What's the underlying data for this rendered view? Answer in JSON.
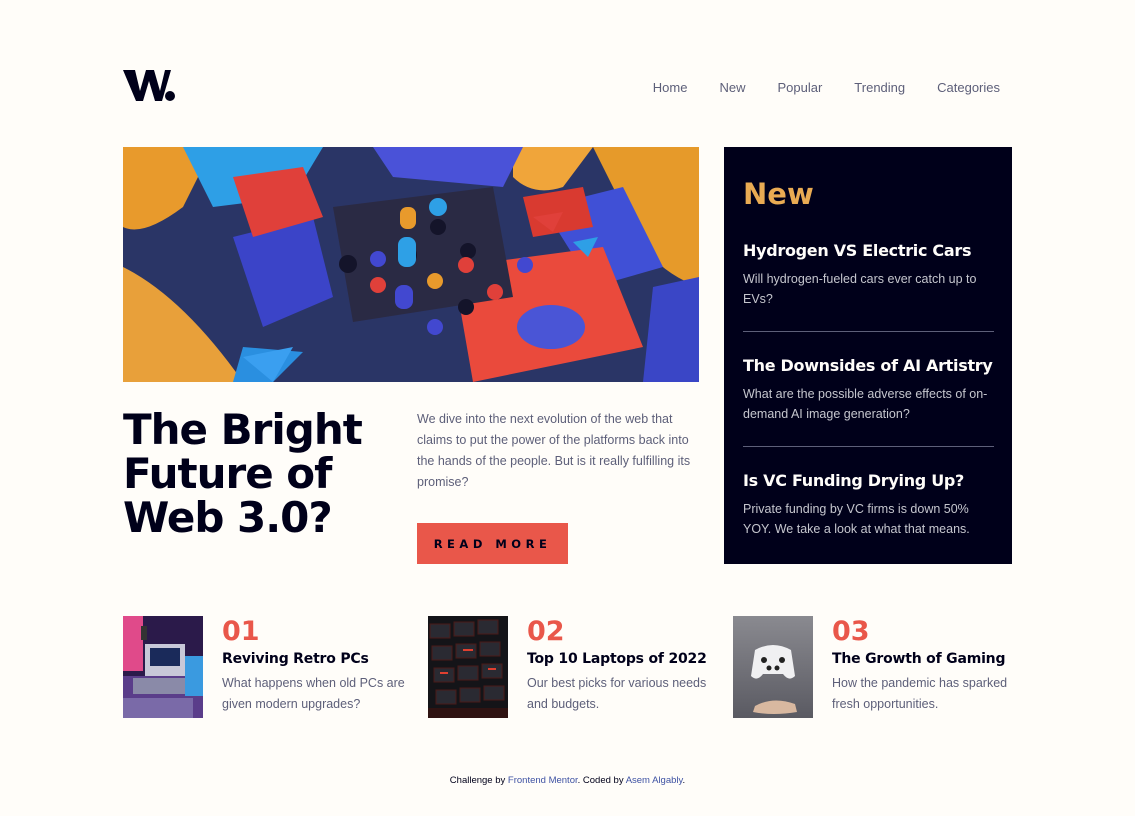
{
  "logo": {
    "icon": "w-logo"
  },
  "nav": {
    "items": [
      {
        "label": "Home"
      },
      {
        "label": "New"
      },
      {
        "label": "Popular"
      },
      {
        "label": "Trending"
      },
      {
        "label": "Categories"
      }
    ]
  },
  "hero": {
    "image": "abstract-3d-blocks-image",
    "title": "The Bright Future of Web 3.0?",
    "description": "We dive into the next evolution of the web that claims to put the power of the platforms back into the hands of the people. But is it really fulfilling its promise?",
    "button_label": "READ MORE"
  },
  "new_panel": {
    "heading": "New",
    "items": [
      {
        "title": "Hydrogen VS Electric Cars",
        "description": "Will hydrogen-fueled cars ever catch up to EVs?"
      },
      {
        "title": "The Downsides of AI Artistry",
        "description": "What are the possible adverse effects of on-demand AI image generation?"
      },
      {
        "title": "Is VC Funding Drying Up?",
        "description": "Private funding by VC firms is down 50% YOY. We take a look at what that means."
      }
    ]
  },
  "articles": [
    {
      "number": "01",
      "title": "Reviving Retro PCs",
      "description": "What happens when old PCs are given modern upgrades?",
      "image": "retro-pcs-image"
    },
    {
      "number": "02",
      "title": "Top 10 Laptops of 2022",
      "description": "Our best picks for various needs and budgets.",
      "image": "laptop-keyboard-image"
    },
    {
      "number": "03",
      "title": "The Growth of Gaming",
      "description": "How the pandemic has sparked fresh opportunities.",
      "image": "game-controller-image"
    }
  ],
  "footer": {
    "prefix": "Challenge by ",
    "link1": "Frontend Mentor",
    "middle": ". Coded by ",
    "link2": "Asem Algably",
    "suffix": "."
  },
  "colors": {
    "background": "#fffdf9",
    "dark": "#00001a",
    "accent_red": "#e9574a",
    "accent_orange": "#e9ab53",
    "grayish_blue": "#5d5f79",
    "link_blue": "#3e52a3"
  }
}
